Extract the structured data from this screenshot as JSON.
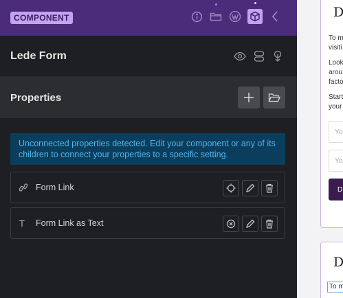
{
  "topbar": {
    "badge": "COMPONENT",
    "icons": [
      "info-icon",
      "folder-icon",
      "wordpress-icon",
      "component-cube-icon",
      "chevron-left-icon"
    ]
  },
  "header": {
    "title": "Lede Form",
    "icons": [
      "eye-icon",
      "layers-icon",
      "touch-icon"
    ]
  },
  "properties": {
    "title": "Properties",
    "add_icon": "plus-icon",
    "folder_icon": "folder-open-icon",
    "notice": "Unconnected properties detected. Edit your component or any of its children to connect your properties to a specific setting.",
    "items": [
      {
        "label": "Form Link",
        "type_icon": "link-icon",
        "glyph": "🔗"
      },
      {
        "label": "Form Link as Text",
        "type_icon": "text-icon",
        "glyph": "T"
      }
    ]
  },
  "preview": {
    "card1": {
      "heading": "D",
      "lines": [
        "To m",
        "visiti",
        "Look",
        "arou",
        "facto",
        "Start",
        "your"
      ],
      "fields": [
        "Yo",
        "Yo"
      ],
      "button": "D"
    },
    "card2": {
      "heading": "D",
      "lines": [
        "To m"
      ]
    }
  },
  "colors": {
    "topbar": "#4a2c7a",
    "badge": "#c3a3f0",
    "panel": "#1e1f22",
    "notice_bg": "#0b3d5c",
    "notice_text": "#4fb6ec"
  }
}
